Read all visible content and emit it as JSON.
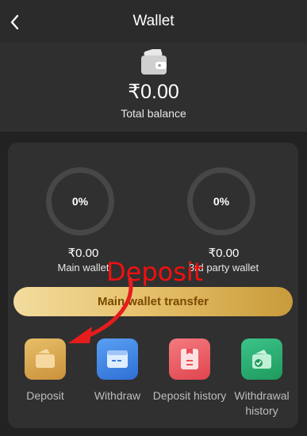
{
  "header": {
    "title": "Wallet",
    "back_icon": "chevron-left-icon"
  },
  "summary": {
    "amount": "₹0.00",
    "label": "Total balance",
    "icon": "wallet-icon"
  },
  "wallets": [
    {
      "percent": "0%",
      "amount": "₹0.00",
      "label": "Main wallet"
    },
    {
      "percent": "0%",
      "amount": "₹0.00",
      "label": "3rd party wallet"
    }
  ],
  "transfer_button": {
    "label": "Main wallet transfer"
  },
  "actions": [
    {
      "label": "Deposit",
      "icon": "deposit-icon",
      "color": "#d9a84a"
    },
    {
      "label": "Withdraw",
      "icon": "withdraw-card-icon",
      "color": "#3f86e6"
    },
    {
      "label": "Deposit history",
      "icon": "deposit-history-icon",
      "color": "#ee5a62"
    },
    {
      "label": "Withdrawal history",
      "icon": "withdrawal-history-icon",
      "color": "#27a86a"
    }
  ],
  "annotation": {
    "text": "Deposit",
    "color": "#f01010"
  }
}
